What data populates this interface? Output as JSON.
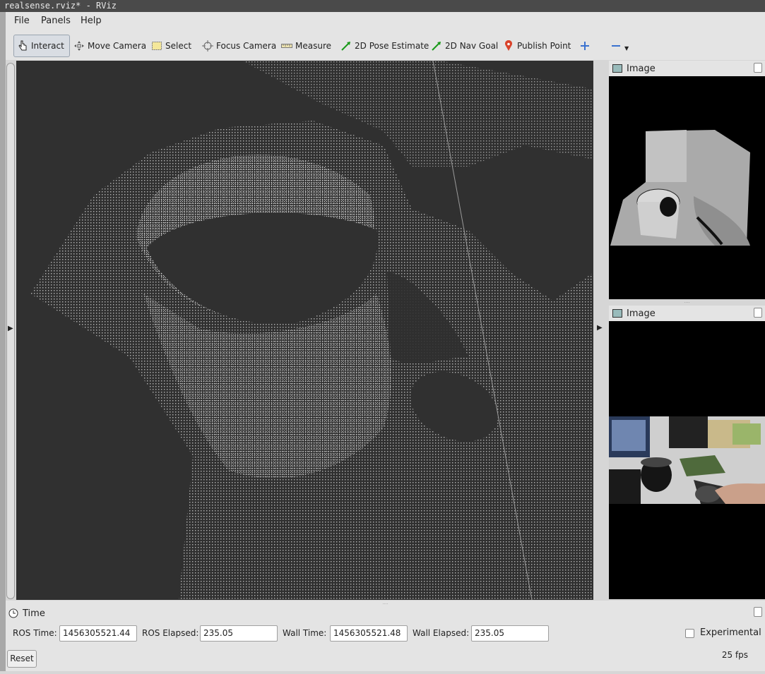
{
  "window": {
    "title": "realsense.rviz* - RViz"
  },
  "menu": {
    "items": [
      "File",
      "Panels",
      "Help"
    ]
  },
  "toolbar": {
    "tools": [
      {
        "label": "Interact",
        "icon": "hand-pointer-icon",
        "active": true
      },
      {
        "label": "Move Camera",
        "icon": "move-camera-icon"
      },
      {
        "label": "Select",
        "icon": "select-box-icon"
      },
      {
        "label": "Focus Camera",
        "icon": "focus-crosshair-icon"
      },
      {
        "label": "Measure",
        "icon": "ruler-icon"
      },
      {
        "label": "2D Pose Estimate",
        "icon": "green-arrow-icon"
      },
      {
        "label": "2D Nav Goal",
        "icon": "green-arrow-icon"
      },
      {
        "label": "Publish Point",
        "icon": "map-pin-icon"
      }
    ],
    "add_icon": "plus-icon",
    "remove_icon": "minus-icon"
  },
  "panels": [
    {
      "title": "Image",
      "content": "depth-image"
    },
    {
      "title": "Image",
      "content": "color-image"
    }
  ],
  "time_panel": {
    "title": "Time",
    "ros_time_label": "ROS Time:",
    "ros_time": "1456305521.44",
    "ros_elapsed_label": "ROS Elapsed:",
    "ros_elapsed": "235.05",
    "wall_time_label": "Wall Time:",
    "wall_time": "1456305521.48",
    "wall_elapsed_label": "Wall Elapsed:",
    "wall_elapsed": "235.05",
    "experimental_label": "Experimental",
    "reset_label": "Reset",
    "fps": "25 fps"
  }
}
